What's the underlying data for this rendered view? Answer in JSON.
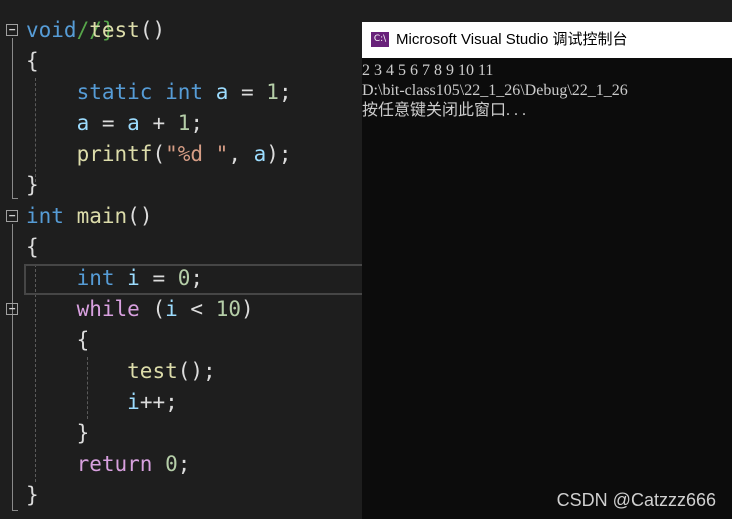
{
  "editor": {
    "lines": {
      "l0": {
        "comment": "//}"
      },
      "l1": {
        "kw": "void",
        "fn": "test",
        "rest": "()"
      },
      "l2": {
        "text": "{"
      },
      "l3": {
        "kw1": "static",
        "kw2": "int",
        "var": "a",
        "op": " = ",
        "num": "1",
        "end": ";"
      },
      "l4": {
        "var1": "a",
        "op1": " = ",
        "var2": "a",
        "op2": " + ",
        "num": "1",
        "end": ";"
      },
      "l5": {
        "fn": "printf",
        "p1": "(",
        "str": "\"%d \"",
        "sep": ", ",
        "var": "a",
        "end": ");"
      },
      "l6": {
        "text": "}"
      },
      "l7": {
        "kw": "int",
        "fn": "main",
        "rest": "()"
      },
      "l8": {
        "text": "{"
      },
      "l9": {
        "kw": "int",
        "var": "i",
        "op": " = ",
        "num": "0",
        "end": ";"
      },
      "l10": {
        "kw": "while",
        "p1": " (",
        "var": "i",
        "op": " < ",
        "num": "10",
        "end": ")"
      },
      "l11": {
        "text": "{"
      },
      "l12": {
        "fn": "test",
        "end": "();"
      },
      "l13": {
        "var": "i",
        "end": "++;"
      },
      "l14": {
        "text": "}"
      },
      "l15": {
        "kw": "return",
        "sp": " ",
        "num": "0",
        "end": ";"
      },
      "l16": {
        "text": "}"
      }
    },
    "fold_markers": [
      "−",
      "−",
      "−"
    ]
  },
  "console": {
    "title": "Microsoft Visual Studio 调试控制台",
    "icon_text": "C:\\",
    "icon": "visual-studio-console-icon",
    "output": [
      "2 3 4 5 6 7 8 9 10 11",
      "D:\\bit-class105\\22_1_26\\Debug\\22_1_26",
      "按任意键关闭此窗口. . ."
    ]
  },
  "watermark": "CSDN @Catzzz666",
  "colors": {
    "keyword": "#569cd6",
    "control": "#d8a0df",
    "function": "#dcdcaa",
    "variable": "#9cdcfe",
    "number": "#b5cea8",
    "string": "#d69d85",
    "comment": "#57a64a"
  }
}
